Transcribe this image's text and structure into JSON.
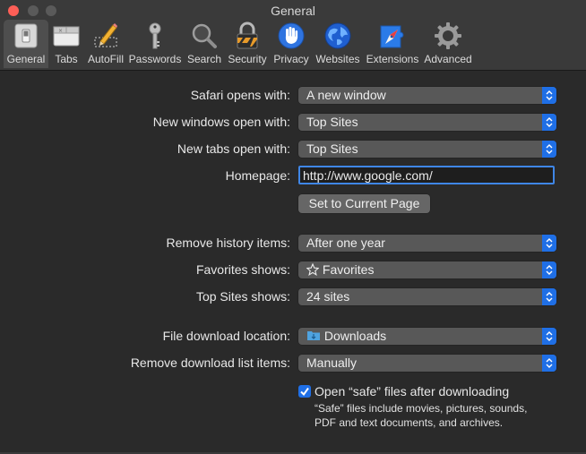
{
  "window": {
    "title": "General"
  },
  "toolbar": {
    "items": [
      {
        "label": "General",
        "icon": "general-switch-icon",
        "selected": true
      },
      {
        "label": "Tabs",
        "icon": "tabs-icon"
      },
      {
        "label": "AutoFill",
        "icon": "autofill-pencil-icon"
      },
      {
        "label": "Passwords",
        "icon": "key-icon"
      },
      {
        "label": "Search",
        "icon": "magnifier-icon"
      },
      {
        "label": "Security",
        "icon": "padlock-icon"
      },
      {
        "label": "Privacy",
        "icon": "hand-icon"
      },
      {
        "label": "Websites",
        "icon": "globe-icon"
      },
      {
        "label": "Extensions",
        "icon": "compass-puzzle-icon"
      },
      {
        "label": "Advanced",
        "icon": "gear-icon"
      }
    ]
  },
  "settings": {
    "safari_opens_with": {
      "label": "Safari opens with:",
      "value": "A new window"
    },
    "new_windows_open_with": {
      "label": "New windows open with:",
      "value": "Top Sites"
    },
    "new_tabs_open_with": {
      "label": "New tabs open with:",
      "value": "Top Sites"
    },
    "homepage": {
      "label": "Homepage:",
      "value": "http://www.google.com/"
    },
    "set_current_page": {
      "label": "Set to Current Page"
    },
    "remove_history_items": {
      "label": "Remove history items:",
      "value": "After one year"
    },
    "favorites_shows": {
      "label": "Favorites shows:",
      "value": "Favorites",
      "icon": "star-outline-icon"
    },
    "top_sites_shows": {
      "label": "Top Sites shows:",
      "value": "24 sites"
    },
    "file_download_location": {
      "label": "File download location:",
      "value": "Downloads",
      "icon": "downloads-folder-icon"
    },
    "remove_download_list_items": {
      "label": "Remove download list items:",
      "value": "Manually"
    },
    "open_safe_files": {
      "label": "Open “safe” files after downloading",
      "checked": true,
      "description": "“Safe” files include movies, pictures, sounds, PDF and text documents, and archives."
    }
  },
  "colors": {
    "accent": "#1f6fe6",
    "close_button": "#fe5f57",
    "background": "#2a2a2a",
    "popup": "#585858"
  }
}
